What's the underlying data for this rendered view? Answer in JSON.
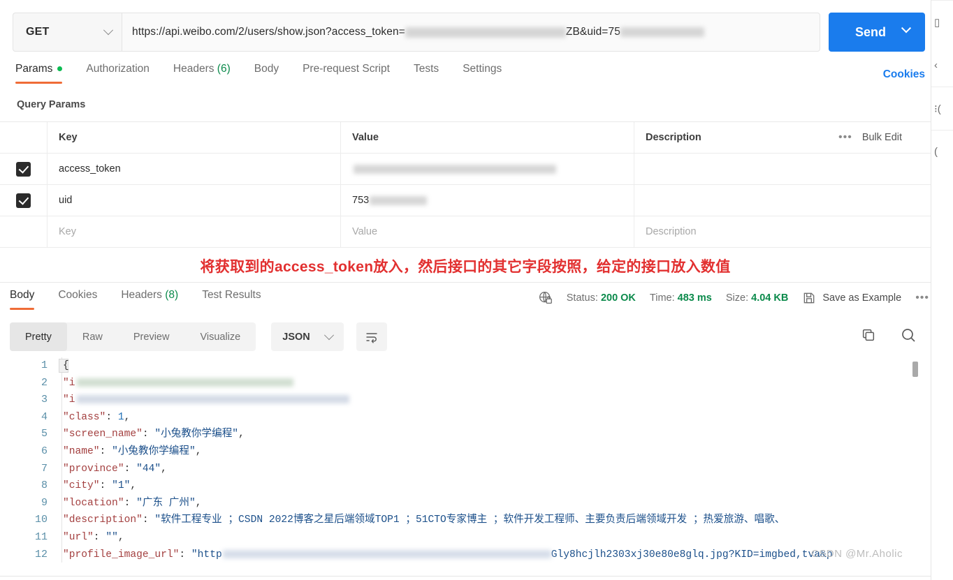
{
  "request": {
    "method": "GET",
    "url_prefix": "https://api.weibo.com/2/users/show.json?access_token=",
    "url_mid": "ZB&uid=7",
    "url_suffix": "5",
    "send_label": "Send",
    "send_caret_icon": "chevron-down-icon",
    "method_caret_icon": "chevron-down-icon"
  },
  "request_tabs": [
    {
      "label": "Params",
      "active": true,
      "has_dot": true
    },
    {
      "label": "Authorization",
      "active": false
    },
    {
      "label": "Headers",
      "count": "(6)",
      "active": false
    },
    {
      "label": "Body",
      "active": false
    },
    {
      "label": "Pre-request Script",
      "active": false
    },
    {
      "label": "Tests",
      "active": false
    },
    {
      "label": "Settings",
      "active": false
    }
  ],
  "cookies_link": "Cookies",
  "query_params": {
    "title": "Query Params",
    "headers": {
      "key": "Key",
      "value": "Value",
      "description": "Description"
    },
    "more_icon": "ellipsis-icon",
    "bulk_edit": "Bulk Edit",
    "rows": [
      {
        "checked": true,
        "key": "access_token",
        "value": "",
        "value_redacted": true,
        "description": ""
      },
      {
        "checked": true,
        "key": "uid",
        "value": "753",
        "value_redacted": true,
        "description": ""
      }
    ],
    "placeholder_row": {
      "key": "Key",
      "value": "Value",
      "description": "Description"
    }
  },
  "annotation": "将获取到的access_token放入，然后接口的其它字段按照，给定的接口放入数值",
  "response_tabs": [
    {
      "label": "Body",
      "active": true
    },
    {
      "label": "Cookies",
      "active": false
    },
    {
      "label": "Headers",
      "count": "(8)",
      "active": false
    },
    {
      "label": "Test Results",
      "active": false
    }
  ],
  "response_meta": {
    "shield_icon": "globe-lock-icon",
    "status_label": "Status:",
    "status_value": "200 OK",
    "time_label": "Time:",
    "time_value": "483 ms",
    "size_label": "Size:",
    "size_value": "4.04 KB",
    "save_icon": "save-icon",
    "save_as_example": "Save as Example",
    "more_icon": "ellipsis-icon"
  },
  "format_toolbar": {
    "views": [
      {
        "label": "Pretty",
        "active": true
      },
      {
        "label": "Raw",
        "active": false
      },
      {
        "label": "Preview",
        "active": false
      },
      {
        "label": "Visualize",
        "active": false
      }
    ],
    "language": "JSON",
    "language_caret_icon": "chevron-down-icon",
    "wrap_icon": "word-wrap-icon",
    "copy_icon": "copy-icon",
    "search_icon": "search-icon"
  },
  "code": {
    "line_numbers": [
      "1",
      "2",
      "3",
      "4",
      "5",
      "6",
      "7",
      "8",
      "9",
      "10",
      "11",
      "12"
    ],
    "lines": [
      {
        "n": 1,
        "tokens": [
          {
            "t": "{",
            "c": "p"
          }
        ]
      },
      {
        "n": 2,
        "tokens": [
          {
            "t": "\"i",
            "c": "k"
          }
        ],
        "redacted": true
      },
      {
        "n": 3,
        "tokens": [
          {
            "t": "\"i",
            "c": "k"
          }
        ],
        "redacted": true
      },
      {
        "n": 4,
        "tokens": [
          {
            "t": "\"class\"",
            "c": "k"
          },
          {
            "t": ": ",
            "c": "p"
          },
          {
            "t": "1",
            "c": "n"
          },
          {
            "t": ",",
            "c": "p"
          }
        ]
      },
      {
        "n": 5,
        "tokens": [
          {
            "t": "\"screen_name\"",
            "c": "k"
          },
          {
            "t": ": ",
            "c": "p"
          },
          {
            "t": "\"小兔教你学编程\"",
            "c": "s"
          },
          {
            "t": ",",
            "c": "p"
          }
        ]
      },
      {
        "n": 6,
        "tokens": [
          {
            "t": "\"name\"",
            "c": "k"
          },
          {
            "t": ": ",
            "c": "p"
          },
          {
            "t": "\"小兔教你学编程\"",
            "c": "s"
          },
          {
            "t": ",",
            "c": "p"
          }
        ]
      },
      {
        "n": 7,
        "tokens": [
          {
            "t": "\"province\"",
            "c": "k"
          },
          {
            "t": ": ",
            "c": "p"
          },
          {
            "t": "\"44\"",
            "c": "s"
          },
          {
            "t": ",",
            "c": "p"
          }
        ]
      },
      {
        "n": 8,
        "tokens": [
          {
            "t": "\"city\"",
            "c": "k"
          },
          {
            "t": ": ",
            "c": "p"
          },
          {
            "t": "\"1\"",
            "c": "s"
          },
          {
            "t": ",",
            "c": "p"
          }
        ]
      },
      {
        "n": 9,
        "tokens": [
          {
            "t": "\"location\"",
            "c": "k"
          },
          {
            "t": ": ",
            "c": "p"
          },
          {
            "t": "\"广东 广州\"",
            "c": "s"
          },
          {
            "t": ",",
            "c": "p"
          }
        ]
      },
      {
        "n": 10,
        "tokens": [
          {
            "t": "\"description\"",
            "c": "k"
          },
          {
            "t": ": ",
            "c": "p"
          },
          {
            "t": "\"软件工程专业 ；CSDN 2022博客之星后端领域TOP1 ；51CTO专家博主 ；软件开发工程师、主要负责后端领域开发 ；热爱旅游、唱歌、",
            "c": "s"
          }
        ]
      },
      {
        "n": 11,
        "tokens": [
          {
            "t": "\"url\"",
            "c": "k"
          },
          {
            "t": ": ",
            "c": "p"
          },
          {
            "t": "\"\"",
            "c": "s"
          },
          {
            "t": ",",
            "c": "p"
          }
        ]
      },
      {
        "n": 12,
        "tokens": [
          {
            "t": "\"profile_image_url\"",
            "c": "k"
          },
          {
            "t": ": ",
            "c": "p"
          },
          {
            "t": "\"http",
            "c": "s"
          }
        ],
        "redacted_mid": true,
        "tail": "Gly8hcjlh2303xj30e80e8glq.jpg?KID=imgbed,tva&p"
      }
    ]
  },
  "watermark": "CSDN @Mr.Aholic",
  "right_rail_icons": [
    "panel-icon",
    "chevron-left-icon",
    "comment-icon",
    "info-circle-icon"
  ],
  "colors": {
    "accent_orange": "#ef6c37",
    "send_blue": "#1a7ced",
    "link_blue": "#1a7ced",
    "success_green": "#0b8a4b",
    "annotation_red": "#e23030"
  }
}
